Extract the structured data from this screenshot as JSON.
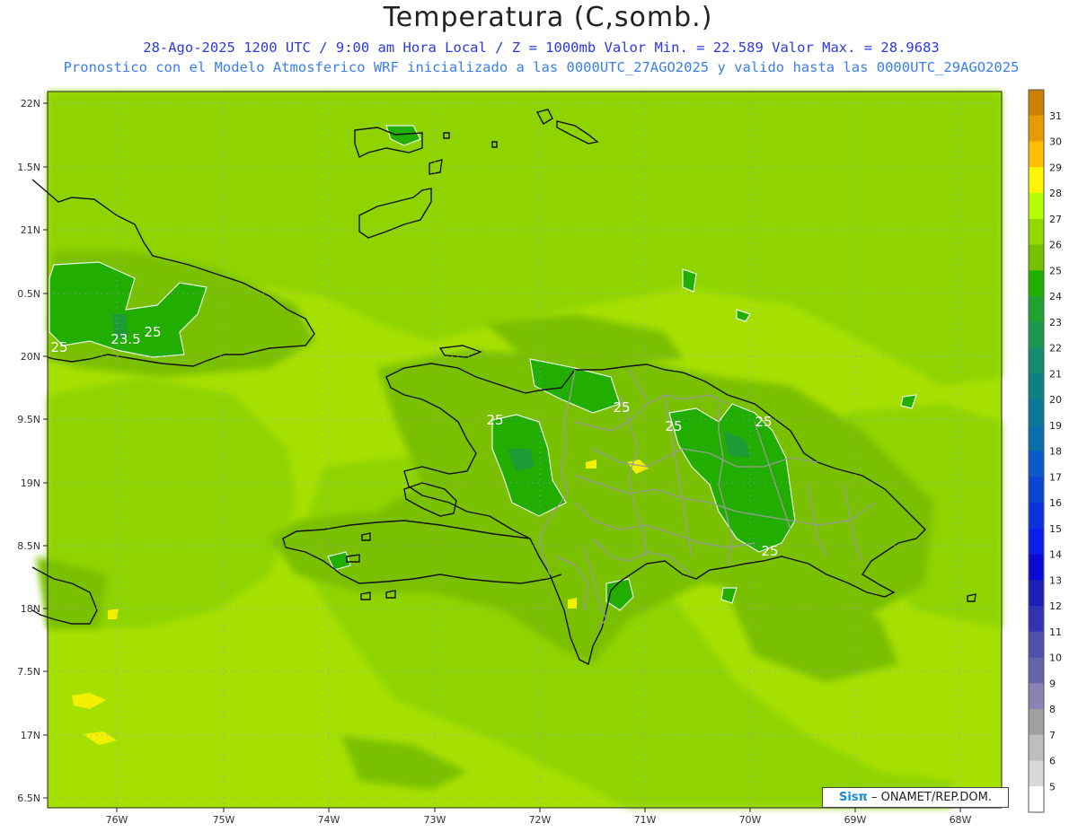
{
  "header": {
    "title": "Temperatura (C,somb.)",
    "subtitle1": "28-Ago-2025  1200 UTC / 9:00 am Hora Local / Z = 1000mb    Valor Min. = 22.589  Valor Max. = 28.9683",
    "subtitle2": "Pronostico con el Modelo Atmosferico WRF inicializado a las 0000UTC_27AGO2025 y valido hasta las  0000UTC_29AGO2025"
  },
  "map": {
    "lat_labels": [
      "22N",
      "1.5N",
      "21N",
      "0.5N",
      "20N",
      "9.5N",
      "19N",
      "8.5N",
      "18N",
      "7.5N",
      "17N",
      "6.5N"
    ],
    "lon_labels": [
      "76W",
      "75W",
      "74W",
      "73W",
      "72W",
      "71W",
      "70W",
      "69W",
      "68W"
    ],
    "contour_labels": [
      "25",
      "23.5",
      "25",
      "25",
      "25",
      "25",
      "25",
      "25"
    ]
  },
  "colorbar": {
    "ticks": [
      "31",
      "30",
      "29",
      "28",
      "27",
      "26",
      "25",
      "24",
      "23",
      "22",
      "21",
      "20",
      "19",
      "18",
      "17",
      "16",
      "15",
      "14",
      "13",
      "12",
      "11",
      "10",
      "9",
      "8",
      "7",
      "6",
      "5"
    ],
    "colors": [
      "#c88200",
      "#e69b00",
      "#ffbf00",
      "#fff500",
      "#b4ff00",
      "#90d800",
      "#76c000",
      "#22b000",
      "#22a032",
      "#1e9650",
      "#148c6e",
      "#0a8282",
      "#0a7896",
      "#0a6eaa",
      "#0a5ac8",
      "#0a46d2",
      "#0a32dc",
      "#0a1ee6",
      "#0a0ad2",
      "#1e1eb4",
      "#3232b4",
      "#5050aa",
      "#6464aa",
      "#8c82b4",
      "#a0a0a0",
      "#bebebe",
      "#d8d8d8",
      "#ffffff"
    ]
  },
  "credit": {
    "logo": "Sisπ",
    "text": "– ONAMET/REP.DOM."
  }
}
